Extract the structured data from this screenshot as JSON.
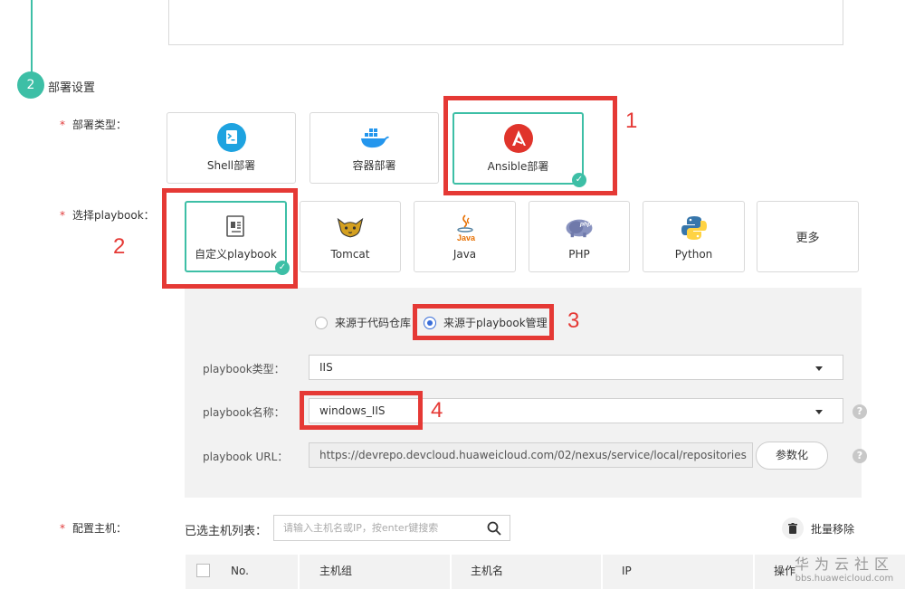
{
  "section": {
    "step_number": "2",
    "title": "部署设置"
  },
  "deploy_type": {
    "label": "部署类型：",
    "options": [
      {
        "label": "Shell部署",
        "icon": "shell-icon"
      },
      {
        "label": "容器部署",
        "icon": "docker-icon"
      },
      {
        "label": "Ansible部署",
        "icon": "ansible-icon",
        "selected": true
      }
    ]
  },
  "playbook_select": {
    "label": "选择playbook：",
    "options": [
      {
        "label": "自定义playbook",
        "icon": "custom-playbook-icon",
        "selected": true
      },
      {
        "label": "Tomcat",
        "icon": "tomcat-icon"
      },
      {
        "label": "Java",
        "icon": "java-icon"
      },
      {
        "label": "PHP",
        "icon": "php-icon"
      },
      {
        "label": "Python",
        "icon": "python-icon"
      },
      {
        "label": "更多",
        "icon": ""
      }
    ]
  },
  "source": {
    "options": [
      {
        "label": "来源于代码仓库",
        "checked": false
      },
      {
        "label": "来源于playbook管理",
        "checked": true
      }
    ]
  },
  "form": {
    "type_label": "playbook类型：",
    "type_value": "IIS",
    "name_label": "playbook名称：",
    "name_value": "windows_IIS",
    "url_label": "playbook URL：",
    "url_value": "https://devrepo.devcloud.huaweicloud.com/02/nexus/service/local/repositories",
    "param_button": "参数化",
    "help": "?"
  },
  "hosts": {
    "label": "配置主机：",
    "selected_label": "已选主机列表：",
    "search_placeholder": "请输入主机名或IP，按enter键搜索",
    "batch_remove": "批量移除",
    "columns": [
      "No.",
      "主机组",
      "主机名",
      "IP",
      "操作"
    ]
  },
  "annotations": [
    "1",
    "2",
    "3",
    "4"
  ],
  "watermark": {
    "main": "华为云社区",
    "sub": "bbs.huaweicloud.com"
  },
  "colors": {
    "accent": "#3dbfa6",
    "annotation": "#e53935",
    "required": "#e03b3b",
    "radio": "#3a6ed8"
  }
}
